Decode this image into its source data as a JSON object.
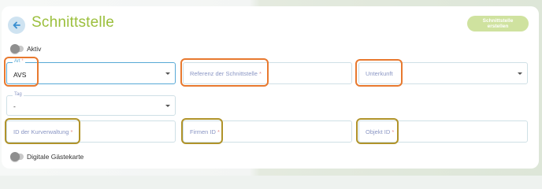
{
  "header": {
    "title": "Schnittstelle",
    "create_button_label": "Schnittstelle erstellen"
  },
  "toggles": {
    "active_label": "Aktiv",
    "digital_card_label": "Digitale Gästekarte"
  },
  "form": {
    "art": {
      "label": "Art",
      "required_mark": "*",
      "value": "AVS"
    },
    "referenz": {
      "placeholder": "Referenz der Schnittstelle",
      "required_mark": "*"
    },
    "unterkunft": {
      "placeholder": "Unterkunft"
    },
    "tag": {
      "label": "Tag",
      "value": "-"
    },
    "kurverwaltung": {
      "placeholder": "ID der Kurverwaltung",
      "required_mark": "*"
    },
    "firmen": {
      "placeholder": "Firmen ID",
      "required_mark": "*"
    },
    "objekt": {
      "placeholder": "Objekt ID",
      "required_mark": "*"
    }
  },
  "colors": {
    "title": "#9bbf3c",
    "focus_border": "#58a9d6",
    "highlight_orange": "#e8792f",
    "highlight_olive": "#b0932a"
  }
}
